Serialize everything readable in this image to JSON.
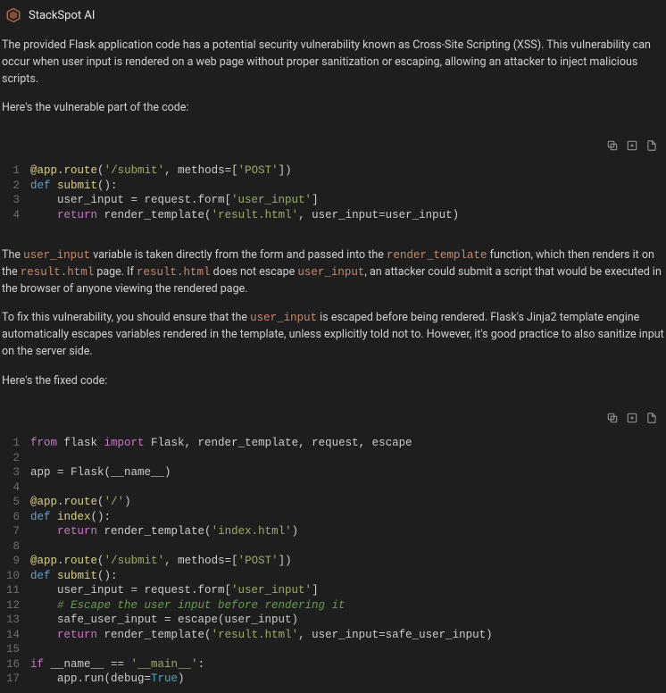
{
  "header": {
    "title": "StackSpot AI"
  },
  "text": {
    "p1": "The provided Flask application code has a potential security vulnerability known as Cross-Site Scripting (XSS). This vulnerability can occur when user input is rendered on a web page without proper sanitization or escaping, allowing an attacker to inject malicious scripts.",
    "p2": "Here's the vulnerable part of the code:",
    "p3a": "The ",
    "p3b": " variable is taken directly from the form and passed into the ",
    "p3c": " function, which then renders it on the ",
    "p3d": " page. If ",
    "p3e": " does not escape ",
    "p3f": ", an attacker could submit a script that would be executed in the browser of anyone viewing the rendered page.",
    "p4a": "To fix this vulnerability, you should ensure that the ",
    "p4b": " is escaped before being rendered. Flask's Jinja2 template engine automatically escapes variables rendered in the template, unless explicitly told not to. However, it's good practice to also sanitize input on the server side.",
    "p5": "Here's the fixed code:",
    "cv_user_input": "user_input",
    "cv_render_template": "render_template",
    "cv_result_html": "result.html"
  },
  "code1": {
    "l1": {
      "a": "@app",
      "b": ".",
      "c": "route",
      "d": "(",
      "e": "'/submit'",
      "f": ", methods=[",
      "g": "'POST'",
      "h": "])"
    },
    "l2": {
      "a": "def",
      "b": " ",
      "c": "submit",
      "d": "():"
    },
    "l3": {
      "a": "    user_input = request.form[",
      "b": "'user_input'",
      "c": "]"
    },
    "l4": {
      "a": "    ",
      "b": "return",
      "c": " render_template(",
      "d": "'result.html'",
      "e": ", user_input=user_input)"
    }
  },
  "code2": {
    "l1": {
      "a": "from",
      "b": " flask ",
      "c": "import",
      "d": " Flask, render_template, request, escape"
    },
    "l2": {
      "a": ""
    },
    "l3": {
      "a": "app = Flask(__name__)"
    },
    "l4": {
      "a": ""
    },
    "l5": {
      "a": "@app",
      "b": ".",
      "c": "route",
      "d": "(",
      "e": "'/'",
      "f": ")"
    },
    "l6": {
      "a": "def",
      "b": " ",
      "c": "index",
      "d": "():"
    },
    "l7": {
      "a": "    ",
      "b": "return",
      "c": " render_template(",
      "d": "'index.html'",
      "e": ")"
    },
    "l8": {
      "a": ""
    },
    "l9": {
      "a": "@app",
      "b": ".",
      "c": "route",
      "d": "(",
      "e": "'/submit'",
      "f": ", methods=[",
      "g": "'POST'",
      "h": "])"
    },
    "l10": {
      "a": "def",
      "b": " ",
      "c": "submit",
      "d": "():"
    },
    "l11": {
      "a": "    user_input = request.form[",
      "b": "'user_input'",
      "c": "]"
    },
    "l12": {
      "a": "    # Escape the user input before rendering it"
    },
    "l13": {
      "a": "    safe_user_input = escape(user_input)"
    },
    "l14": {
      "a": "    ",
      "b": "return",
      "c": " render_template(",
      "d": "'result.html'",
      "e": ", user_input=safe_user_input)"
    },
    "l15": {
      "a": ""
    },
    "l16": {
      "a": "if",
      "b": " __name__ == ",
      "c": "'__main__'",
      "d": ":"
    },
    "l17": {
      "a": "    app.run(debug=",
      "b": "True",
      "c": ")"
    }
  },
  "nums": {
    "n1": "1",
    "n2": "2",
    "n3": "3",
    "n4": "4",
    "n5": "5",
    "n6": "6",
    "n7": "7",
    "n8": "8",
    "n9": "9",
    "n10": "10",
    "n11": "11",
    "n12": "12",
    "n13": "13",
    "n14": "14",
    "n15": "15",
    "n16": "16",
    "n17": "17"
  }
}
